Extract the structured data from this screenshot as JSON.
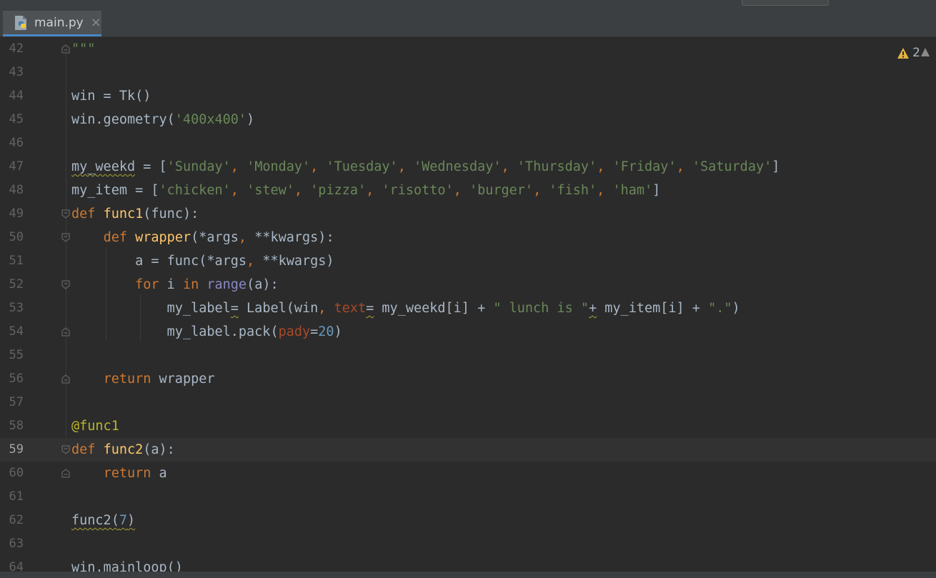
{
  "tab": {
    "filename": "main.py",
    "close_glyph": "×"
  },
  "inspections": {
    "warning_count": "2",
    "color": "#e3b341"
  },
  "lines": [
    {
      "n": "42"
    },
    {
      "n": "43"
    },
    {
      "n": "44"
    },
    {
      "n": "45"
    },
    {
      "n": "46"
    },
    {
      "n": "47"
    },
    {
      "n": "48"
    },
    {
      "n": "49"
    },
    {
      "n": "50"
    },
    {
      "n": "51"
    },
    {
      "n": "52"
    },
    {
      "n": "53"
    },
    {
      "n": "54"
    },
    {
      "n": "55"
    },
    {
      "n": "56"
    },
    {
      "n": "57"
    },
    {
      "n": "58"
    },
    {
      "n": "59"
    },
    {
      "n": "60"
    },
    {
      "n": "61"
    },
    {
      "n": "62"
    },
    {
      "n": "63"
    },
    {
      "n": "64"
    }
  ],
  "code": {
    "l42": {
      "doc": "\"\"\""
    },
    "l44": {
      "a": "win = Tk()"
    },
    "l45": {
      "a": "win.geometry(",
      "s": "'400x400'",
      "b": ")"
    },
    "l47": {
      "v": "my_weekd",
      "eq": " = [",
      "items": [
        "'Sunday'",
        "'Monday'",
        "'Tuesday'",
        "'Wednesday'",
        "'Thursday'",
        "'Friday'",
        "'Saturday'"
      ],
      "end": "]"
    },
    "l48": {
      "v": "my_item = [",
      "items": [
        "'chicken'",
        "'stew'",
        "'pizza'",
        "'risotto'",
        "'burger'",
        "'fish'",
        "'ham'"
      ],
      "end": "]"
    },
    "l49": {
      "kw": "def",
      "fn": "func1",
      "rest": "(func):"
    },
    "l50": {
      "kw": "def",
      "fn": "wrapper",
      "p1": "(*args",
      "c": ",",
      "p2": " **kwargs):"
    },
    "l51": {
      "a": "a = func(*args",
      "c": ",",
      "b": " **kwargs)"
    },
    "l52": {
      "kw1": "for",
      "i": " i ",
      "kw2": "in",
      "bi": "range",
      "rest": "(a):"
    },
    "l53": {
      "a": "my_label",
      "eq1": "=",
      "b": " Label(win",
      "c": ",",
      "p": "text",
      "eq2": "=",
      "d": " my_weekd[i] + ",
      "s1": "\" lunch is \"",
      "plus": "+",
      "e": " my_item[i] + ",
      "s2": "\".\"",
      "f": ")"
    },
    "l54": {
      "a": "my_label.pack(",
      "p": "pady",
      "eq": "=",
      "n": "20",
      "b": ")"
    },
    "l56": {
      "kw": "return",
      "rest": " wrapper"
    },
    "l58": {
      "dec": "@func1"
    },
    "l59": {
      "kw": "def",
      "fn": "func2",
      "rest": "(a):"
    },
    "l60": {
      "kw": "return",
      "rest": " a"
    },
    "l62": {
      "fn": "func2(",
      "n": "7",
      "end": ")"
    },
    "l64": {
      "a": "win.mainloop()"
    }
  }
}
